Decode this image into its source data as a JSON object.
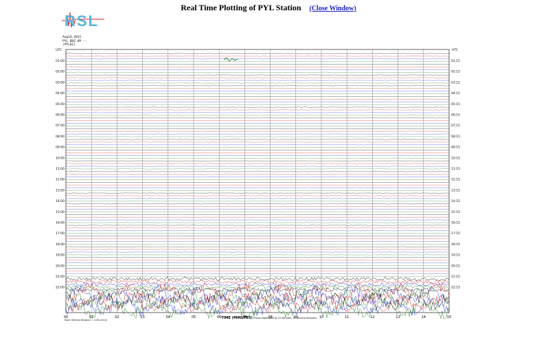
{
  "header": {
    "title": "Real Time Plotting of PYL Station",
    "close_link": "(Close Window)"
  },
  "logo": {
    "text": "RSL"
  },
  "meta": {
    "lines": [
      "Aug14,2015",
      "PYL BHZ HP --",
      "(PYL01)"
    ]
  },
  "plot": {
    "utc_label": "UTC",
    "left_times": [
      "01:00",
      "02:00",
      "03:00",
      "04:00",
      "05:00",
      "06:00",
      "07:00",
      "08:00",
      "09:00",
      "10:00",
      "11:00",
      "12:00",
      "13:00",
      "14:00",
      "15:00",
      "16:00",
      "17:00",
      "18:00",
      "19:00",
      "20:00",
      "21:00",
      "22:00"
    ],
    "right_times": [
      "01:15",
      "02:15",
      "03:15",
      "04:15",
      "05:15",
      "06:15",
      "07:15",
      "08:15",
      "09:15",
      "10:15",
      "11:15",
      "12:15",
      "13:15",
      "14:15",
      "15:15",
      "16:15",
      "17:15",
      "18:15",
      "19:15",
      "20:15",
      "21:15",
      "22:15"
    ],
    "x_ticks": [
      "00",
      "01",
      "02",
      "03",
      "04",
      "05",
      "06",
      "07",
      "08",
      "09",
      "10",
      "11",
      "12",
      "13",
      "14",
      "15"
    ],
    "x_axis_label": "TIME (MINUTES)",
    "x_axis_note": "Traces separated at 15 minutes, 28 vertical divisions",
    "footer_note": "Each Vertical Division = 2.0e-4 m/s",
    "trace_colors": [
      "#000000",
      "#d01818",
      "#1a28d8",
      "#1a7a1a"
    ]
  }
}
